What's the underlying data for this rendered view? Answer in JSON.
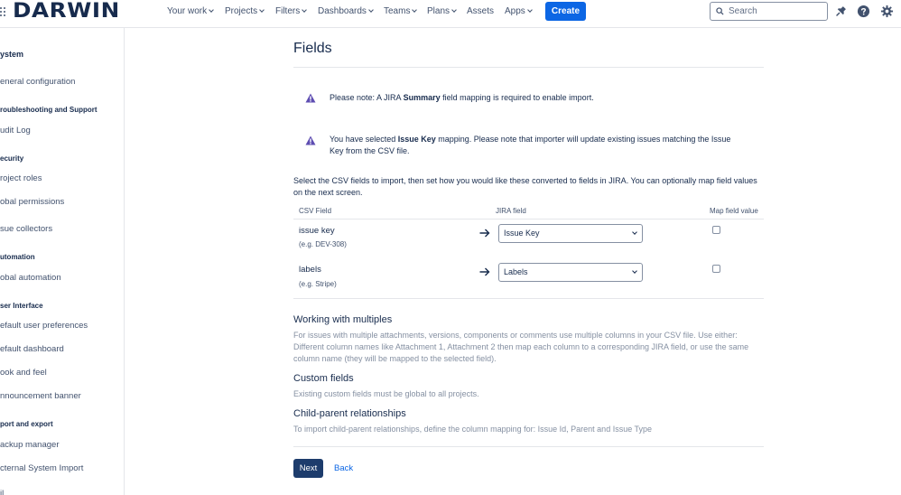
{
  "header": {
    "logo": "DARWIN",
    "nav": [
      {
        "label": "Your work"
      },
      {
        "label": "Projects"
      },
      {
        "label": "Filters"
      },
      {
        "label": "Dashboards"
      },
      {
        "label": "Teams"
      },
      {
        "label": "Plans"
      },
      {
        "label": "Assets"
      },
      {
        "label": "Apps"
      }
    ],
    "create_label": "Create",
    "search_placeholder": "Search",
    "icons": [
      "notification-bell-icon",
      "help-icon",
      "settings-gear-icon"
    ]
  },
  "sidebar": {
    "sections": [
      {
        "heading": "ystem",
        "items": [
          "eneral configuration"
        ]
      },
      {
        "heading": "roubleshooting and Support",
        "items": [
          "udit Log"
        ]
      },
      {
        "heading": "ecurity",
        "items": [
          "roject roles",
          "obal permissions",
          "sue collectors"
        ]
      },
      {
        "heading": "utomation",
        "items": [
          "obal automation"
        ]
      },
      {
        "heading": "ser Interface",
        "items": [
          "efault user preferences",
          "efault dashboard",
          "ook and feel",
          "nnouncement banner"
        ]
      },
      {
        "heading": "port and export",
        "items": [
          "ackup manager",
          "cternal System Import",
          "il"
        ]
      }
    ]
  },
  "main": {
    "title": "Fields",
    "notices": [
      {
        "pre": "Please note: A JIRA ",
        "bold": "Summary",
        "post": " field mapping is required to enable import."
      },
      {
        "pre": "You have selected ",
        "bold": "Issue Key",
        "post": " mapping. Please note that importer will update existing issues matching the Issue Key from the CSV file."
      }
    ],
    "intro": "Select the CSV fields to import, then set how you would like these converted to fields in JIRA. You can optionally map field values on the next screen.",
    "columns": {
      "csv": "CSV Field",
      "jira": "JIRA field",
      "map": "Map field value"
    },
    "rows": [
      {
        "name": "issue key",
        "example": "(e.g. DEV-308)",
        "jira_field": "Issue Key",
        "map_value": false
      },
      {
        "name": "labels",
        "example": "(e.g. Stripe)",
        "jira_field": "Labels",
        "map_value": false
      }
    ],
    "sections": [
      {
        "heading": "Working with multiples",
        "text": "For issues with multiple attachments, versions, components or comments use multiple columns in your CSV file. Use either: Different column names like Attachment 1, Attachment 2 then map each column to a corresponding JIRA field, or use the same column name (they will be mapped to the selected field)."
      },
      {
        "heading": "Custom fields",
        "text": "Existing custom fields must be global to all projects."
      },
      {
        "heading": "Child-parent relationships",
        "text": "To import child-parent relationships, define the column mapping for: Issue Id, Parent and Issue Type"
      }
    ],
    "next_label": "Next",
    "back_label": "Back"
  }
}
